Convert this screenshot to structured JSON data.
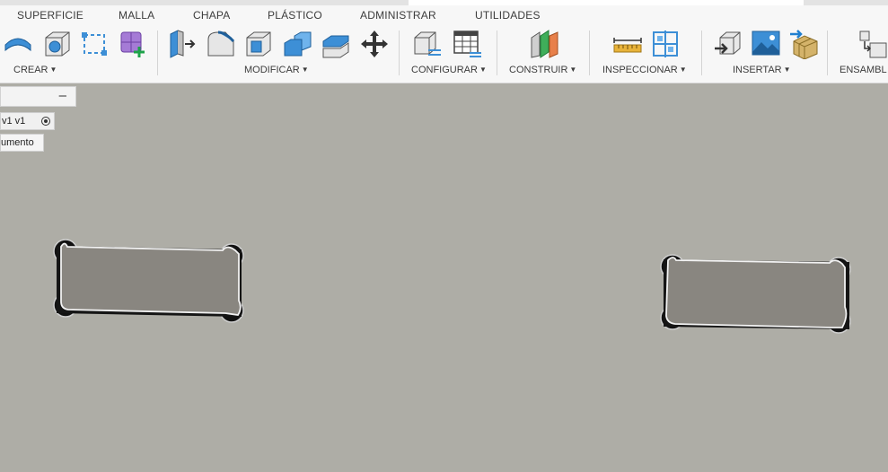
{
  "tabs": [
    "SUPERFICIE",
    "MALLA",
    "CHAPA",
    "PLÁSTICO",
    "ADMINISTRAR",
    "UTILIDADES"
  ],
  "groups": {
    "crear": "CREAR",
    "modificar": "MODIFICAR",
    "configurar": "CONFIGURAR",
    "construir": "CONSTRUIR",
    "inspeccionar": "INSPECCIONAR",
    "insertar": "INSERTAR",
    "ensamblar": "ENSAMBL"
  },
  "browser": {
    "collapse_symbol": "–",
    "node_label": "v1 v1",
    "tooltip_label": "umento"
  },
  "colors": {
    "toolbar_bg": "#f7f7f7",
    "viewport_bg": "#aeada6",
    "pocket_face": "#898680",
    "pocket_edge": "#f2f2f2",
    "accent_blue": "#3d8fd6"
  }
}
